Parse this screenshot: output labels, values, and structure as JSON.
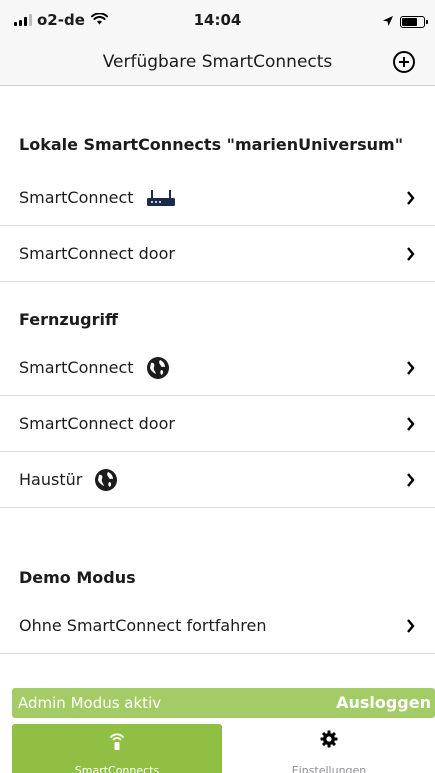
{
  "status_bar": {
    "carrier": "o2-de",
    "time": "14:04",
    "icons": [
      "signal-icon",
      "wifi-icon",
      "location-arrow-icon",
      "battery-icon"
    ]
  },
  "nav": {
    "title": "Verfügbare SmartConnects",
    "add_icon": "plus-circle-icon"
  },
  "sections": {
    "local": {
      "title": "Lokale SmartConnects \"marienUniversum\"",
      "items": [
        {
          "label": "SmartConnect",
          "icon": "router-icon"
        },
        {
          "label": "SmartConnect door"
        }
      ]
    },
    "remote": {
      "title": "Fernzugriff",
      "items": [
        {
          "label": "SmartConnect",
          "icon": "globe-icon"
        },
        {
          "label": "SmartConnect door"
        },
        {
          "label": "Haustür",
          "icon": "globe-icon"
        }
      ]
    },
    "demo": {
      "title": "Demo Modus",
      "items": [
        {
          "label": "Ohne SmartConnect fortfahren"
        }
      ]
    }
  },
  "admin": {
    "status_text": "Admin Modus aktiv",
    "logout_label": "Ausloggen"
  },
  "tabs": [
    {
      "label": "SmartConnects",
      "icon": "wifi-remote-icon",
      "active": true
    },
    {
      "label": "Einstellungen",
      "icon": "gear-icon",
      "active": false
    }
  ],
  "colors": {
    "accent_green": "#8fc043",
    "banner_green": "#a4cc66",
    "nav_background": "#f7f7f7"
  }
}
